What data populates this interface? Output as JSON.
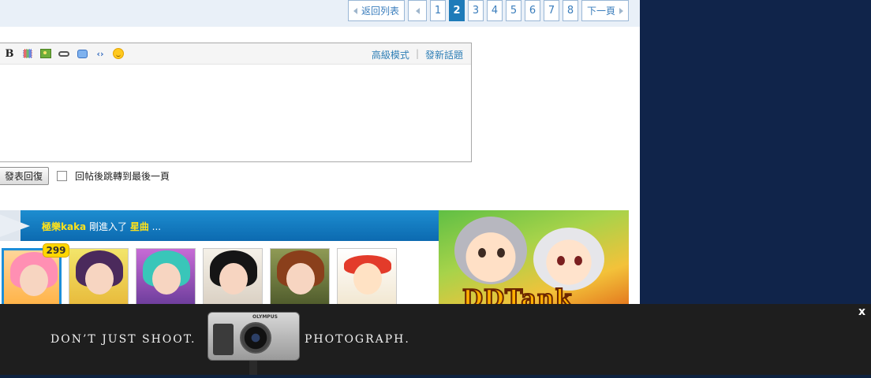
{
  "pager": {
    "back_label": "返回列表",
    "pages": [
      "1",
      "2",
      "3",
      "4",
      "5",
      "6",
      "7",
      "8"
    ],
    "current_page": "2",
    "next_label": "下一頁"
  },
  "editor": {
    "toolbar_icons": [
      "bold-icon",
      "color-grid-icon",
      "image-icon",
      "link-icon",
      "quote-icon",
      "code-icon",
      "smiley-icon"
    ],
    "advanced_mode_label": "高級模式",
    "separator": "|",
    "new_topic_label": "發新話題"
  },
  "reply": {
    "submit_label": "發表回復",
    "jump_last_page_label": "回帖後跳轉到最後一頁"
  },
  "banner": {
    "user": "極樂kaka",
    "action": " 剛進入了 ",
    "room": "星曲",
    "suffix": " ..."
  },
  "avatars": {
    "badge_count": "299",
    "count": 6
  },
  "game_ad": {
    "logo_text": "DDTank"
  },
  "bottom_ad": {
    "text_left": "DON’T JUST SHOOT.",
    "text_right": "PHOTOGRAPH.",
    "camera_brand": "OLYMPUS",
    "close_label": "x"
  }
}
